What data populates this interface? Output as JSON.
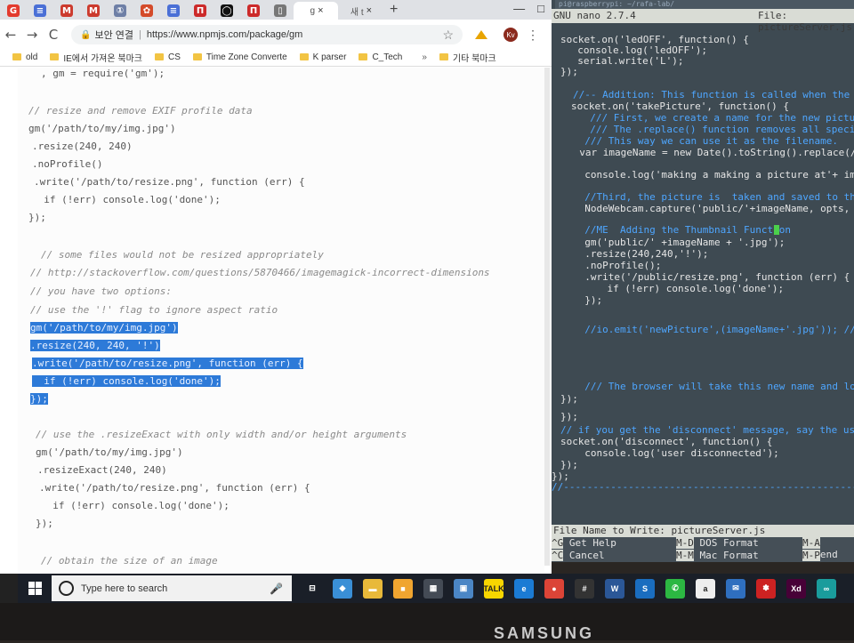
{
  "browser": {
    "tabs": [
      {
        "icon": "G",
        "color": "#e33b2e"
      },
      {
        "icon": "≡",
        "color": "#4a6fd6"
      },
      {
        "icon": "M",
        "color": "#cc3b2e"
      },
      {
        "icon": "M",
        "color": "#cc3b2e"
      },
      {
        "icon": "①",
        "color": "#6e7fa6"
      },
      {
        "icon": "✿",
        "color": "#d44b2a"
      },
      {
        "icon": "≡",
        "color": "#4a6fd6"
      },
      {
        "icon": "П",
        "color": "#cc2a2a"
      },
      {
        "icon": "◯",
        "color": "#111111"
      },
      {
        "icon": "П",
        "color": "#cc2a2a"
      },
      {
        "icon": "▯",
        "color": "#777777"
      }
    ],
    "active_tab": {
      "label": "g",
      "close": "×"
    },
    "extra_tab": {
      "label": "새 t",
      "close": "×"
    },
    "new_tab": "+",
    "window_controls": {
      "minimize": "—",
      "maximize": "□"
    },
    "nav": {
      "back": "←",
      "forward": "→",
      "reload": "C"
    },
    "address": {
      "secure_label": "보안 연결",
      "url": "https://www.npmjs.com/package/gm"
    },
    "avatar": "Kv",
    "bookmarks": [
      "old",
      "IE에서 가져온 북마크",
      "CS",
      "Time Zone Converte",
      "K parser",
      "C_Tech"
    ],
    "bookmarks_more": "»",
    "bookmarks_other": "기타 북마크"
  },
  "code_lines": [
    {
      "text": ", gm = require('gm');",
      "kind": "code"
    },
    {
      "text": "// resize and remove EXIF profile data",
      "kind": "comment"
    },
    {
      "text": "gm('/path/to/my/img.jpg')",
      "kind": "code"
    },
    {
      "text": ".resize(240, 240)",
      "kind": "code"
    },
    {
      "text": ".noProfile()",
      "kind": "code"
    },
    {
      "text": ".write('/path/to/resize.png', function (err) {",
      "kind": "code"
    },
    {
      "text": "  if (!err) console.log('done');",
      "kind": "code"
    },
    {
      "text": "});",
      "kind": "code"
    },
    {
      "text": "// some files would not be resized appropriately",
      "kind": "comment"
    },
    {
      "text": "// http://stackoverflow.com/questions/5870466/imagemagick-incorrect-dimensions",
      "kind": "comment"
    },
    {
      "text": "// you have two options:",
      "kind": "comment"
    },
    {
      "text": "// use the '!' flag to ignore aspect ratio",
      "kind": "comment"
    },
    {
      "text": "gm('/path/to/my/img.jpg')",
      "kind": "selected"
    },
    {
      "text": ".resize(240, 240, '!')",
      "kind": "selected"
    },
    {
      "text": ".write('/path/to/resize.png', function (err) {",
      "kind": "selected"
    },
    {
      "text": "  if (!err) console.log('done');",
      "kind": "selected"
    },
    {
      "text": "});",
      "kind": "selected"
    },
    {
      "text": "// use the .resizeExact with only width and/or height arguments",
      "kind": "comment"
    },
    {
      "text": "gm('/path/to/my/img.jpg')",
      "kind": "code"
    },
    {
      "text": ".resizeExact(240, 240)",
      "kind": "code"
    },
    {
      "text": ".write('/path/to/resize.png', function (err) {",
      "kind": "code"
    },
    {
      "text": "  if (!err) console.log('done');",
      "kind": "code"
    },
    {
      "text": "});",
      "kind": "code"
    },
    {
      "text": "// obtain the size of an image",
      "kind": "comment"
    }
  ],
  "terminal": {
    "title": "pi@raspberrypi: ~/rafa-lab/",
    "nano_version": "GNU nano 2.7.4",
    "file_label": "File: pictureServer.js",
    "lines": [
      {
        "text": "socket.on('ledOFF', function() {",
        "kind": "code"
      },
      {
        "text": "  console.log('ledOFF');",
        "kind": "code"
      },
      {
        "text": "  serial.write('L');",
        "kind": "code"
      },
      {
        "text": "});",
        "kind": "code"
      },
      {
        "text": "//-- Addition: This function is called when the client",
        "kind": "comment"
      },
      {
        "text": "socket.on('takePicture', function() {",
        "kind": "code"
      },
      {
        "text": "  /// First, we create a name for the new picture.",
        "kind": "comment"
      },
      {
        "text": "  /// The .replace() function removes all special cha",
        "kind": "comment"
      },
      {
        "text": "  /// This way we can use it as the filename.",
        "kind": "comment"
      },
      {
        "text": "  var imageName = new Date().toString().replace(/[&\\/",
        "kind": "code"
      },
      {
        "text": "  console.log('making a making a picture at'+ imageNa",
        "kind": "code"
      },
      {
        "text": "  //Third, the picture is  taken and saved to the `pu",
        "kind": "comment"
      },
      {
        "text": "  NodeWebcam.capture('public/'+imageName, opts, funct",
        "kind": "code"
      },
      {
        "text": "  //ME  Adding the Thumbnail Function",
        "kind": "comment"
      },
      {
        "text": "  gm('public/' +imageName + '.jpg');",
        "kind": "code"
      },
      {
        "text": "  .resize(240,240,'!');",
        "kind": "code"
      },
      {
        "text": "  .noProfile();",
        "kind": "code"
      },
      {
        "text": "  .write('/public/resize.png', function (err) {",
        "kind": "code"
      },
      {
        "text": "    if (!err) console.log('done');",
        "kind": "code"
      },
      {
        "text": "  });",
        "kind": "code"
      },
      {
        "text": "  //io.emit('newPicture',(imageName+'.jpg')); ///Last",
        "kind": "comment"
      },
      {
        "text": "  /// The browser will take this new name and load the",
        "kind": "comment"
      },
      {
        "text": "});",
        "kind": "code"
      },
      {
        "text": "});",
        "kind": "code"
      },
      {
        "text": "// if you get the 'disconnect' message, say the user d",
        "kind": "comment"
      },
      {
        "text": "socket.on('disconnect', function() {",
        "kind": "code"
      },
      {
        "text": "  console.log('user disconnected');",
        "kind": "code"
      },
      {
        "text": "});",
        "kind": "code"
      },
      {
        "text": "});",
        "kind": "code"
      },
      {
        "text": "//----------------------------------------------------",
        "kind": "comment"
      }
    ],
    "prompt": "File Name to Write: pictureServer.js",
    "shortcuts": [
      {
        "key": "^G",
        "label": "Get Help"
      },
      {
        "key": "M-D",
        "label": "DOS Format"
      },
      {
        "key": "M-A",
        "label": "Append"
      },
      {
        "key": "^C",
        "label": "Cancel"
      },
      {
        "key": "M-M",
        "label": "Mac Format"
      },
      {
        "key": "M-P",
        "label": "Prepend"
      }
    ]
  },
  "taskbar": {
    "search_placeholder": "Type here to search",
    "icons": [
      {
        "name": "task-view-icon",
        "glyph": "⊟",
        "color": "#1a1f28"
      },
      {
        "name": "store-icon",
        "glyph": "◆",
        "color": "#3a8fd6"
      },
      {
        "name": "file-explorer-icon",
        "glyph": "▬",
        "color": "#e8b93a"
      },
      {
        "name": "sticky-notes-icon",
        "glyph": "■",
        "color": "#f0a530"
      },
      {
        "name": "calculator-icon",
        "glyph": "▦",
        "color": "#444b55"
      },
      {
        "name": "photos-icon",
        "glyph": "▣",
        "color": "#4b86c5"
      },
      {
        "name": "kakaotalk-icon",
        "glyph": "TALK",
        "color": "#f7d600"
      },
      {
        "name": "edge-icon",
        "glyph": "e",
        "color": "#1b7bd4"
      },
      {
        "name": "chrome-icon",
        "glyph": "●",
        "color": "#db4437"
      },
      {
        "name": "slack-icon",
        "glyph": "#",
        "color": "#333333"
      },
      {
        "name": "word-icon",
        "glyph": "W",
        "color": "#2b5797"
      },
      {
        "name": "skype-icon",
        "glyph": "S",
        "color": "#1a6dbf"
      },
      {
        "name": "whatsapp-icon",
        "glyph": "✆",
        "color": "#2cb742"
      },
      {
        "name": "amazon-icon",
        "glyph": "a",
        "color": "#eeeeee"
      },
      {
        "name": "mail-icon",
        "glyph": "✉",
        "color": "#2f6fbf"
      },
      {
        "name": "app-icon",
        "glyph": "✽",
        "color": "#cc2222"
      },
      {
        "name": "xd-icon",
        "glyph": "Xd",
        "color": "#470137"
      },
      {
        "name": "arduino-icon",
        "glyph": "∞",
        "color": "#1a9c9c"
      }
    ]
  },
  "monitor_brand": "SAMSUNG"
}
